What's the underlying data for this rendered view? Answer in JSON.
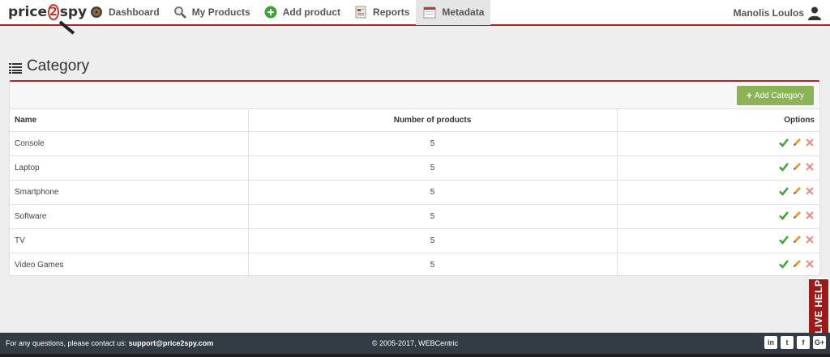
{
  "nav": {
    "logo_text_a": "price",
    "logo_text_b": "2",
    "logo_text_c": "spy",
    "items": [
      {
        "label": "Dashboard",
        "icon": "gauge-icon"
      },
      {
        "label": "My Products",
        "icon": "magnifier-icon"
      },
      {
        "label": "Add product",
        "icon": "plus-circle-icon"
      },
      {
        "label": "Reports",
        "icon": "report-icon"
      },
      {
        "label": "Metadata",
        "icon": "calendar-icon",
        "active": true
      }
    ],
    "user_name": "Manolis Loulos"
  },
  "page": {
    "title": "Category"
  },
  "toolbar": {
    "add_category_label": "Add Category"
  },
  "table": {
    "headers": [
      "Name",
      "Number of products",
      "Options"
    ],
    "rows": [
      {
        "name": "Console",
        "count": "5"
      },
      {
        "name": "Laptop",
        "count": "5"
      },
      {
        "name": "Smartphone",
        "count": "5"
      },
      {
        "name": "Software",
        "count": "5"
      },
      {
        "name": "TV",
        "count": "5"
      },
      {
        "name": "Video Games",
        "count": "5"
      }
    ]
  },
  "live_help": "LIVE HELP",
  "footer": {
    "contact_prefix": "For any questions, please contact us:",
    "contact_email": "support@price2spy.com",
    "copyright": "© 2005-2017, WEBCentric",
    "social": [
      "in",
      "t",
      "f",
      "G+"
    ]
  },
  "colors": {
    "accent_red": "#a52a2a",
    "add_button_green": "#8cb356",
    "footer_bg": "#333b45"
  }
}
